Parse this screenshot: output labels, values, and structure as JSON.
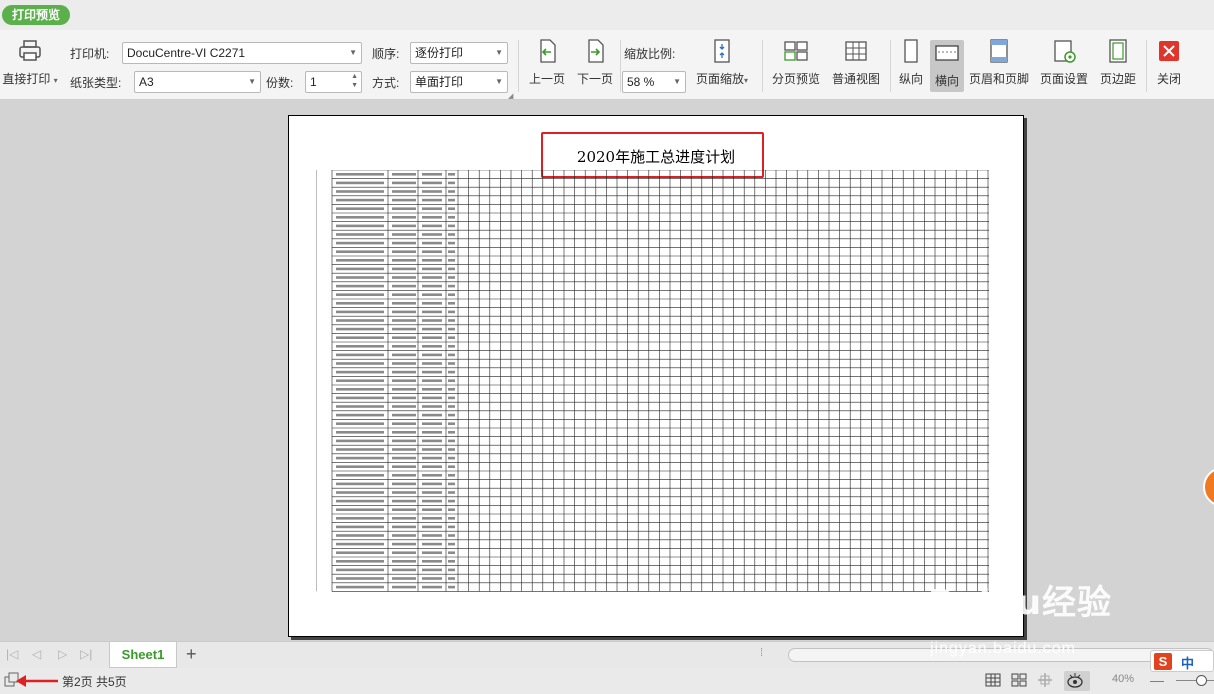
{
  "app": {
    "title": "打印预览"
  },
  "ribbon": {
    "direct_print": "直接打印",
    "printer_label": "打印机:",
    "printer_value": "DocuCentre-VI C2271",
    "paper_label": "纸张类型:",
    "paper_value": "A3",
    "copies_label": "份数:",
    "copies_value": "1",
    "order_label": "顺序:",
    "order_value": "逐份打印",
    "mode_label": "方式:",
    "mode_value": "单面打印",
    "prev_page": "上一页",
    "next_page": "下一页",
    "zoom_label": "缩放比例:",
    "zoom_value": "58 %",
    "page_zoom": "页面缩放",
    "page_break_preview": "分页预览",
    "normal_view": "普通视图",
    "portrait": "纵向",
    "landscape": "横向",
    "header_footer": "页眉和页脚",
    "page_setup": "页面设置",
    "margins": "页边距",
    "close": "关闭"
  },
  "document": {
    "title": "2020年施工总进度计划"
  },
  "tabs": {
    "sheet1": "Sheet1"
  },
  "status": {
    "page_info": "第2页 共5页",
    "zoom_percent": "40%"
  },
  "watermark": {
    "logo": "Baidu经验",
    "url": "jingyan.baidu.com"
  },
  "ime": {
    "s": "S",
    "lang": "中"
  },
  "colors": {
    "accent_green": "#5bb04c",
    "close_red": "#e0352b",
    "highlight_red": "#e02020"
  }
}
